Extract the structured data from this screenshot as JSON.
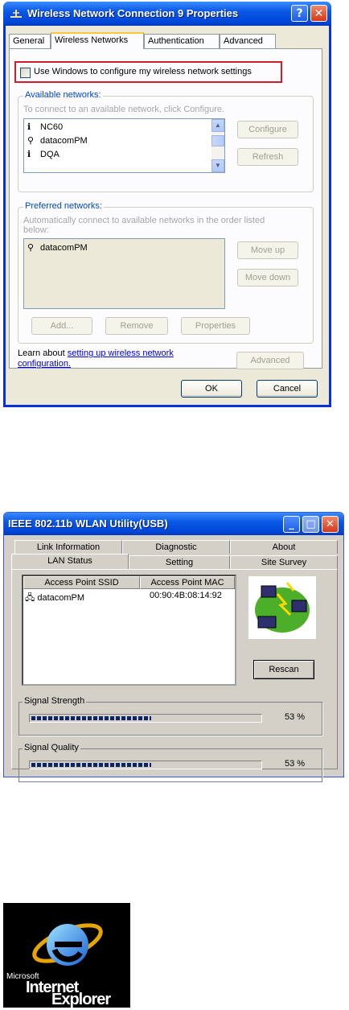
{
  "win1": {
    "title": "Wireless Network Connection 9 Properties",
    "help_glyph": "?",
    "close_glyph": "✕",
    "tabs": [
      "General",
      "Wireless Networks",
      "Authentication",
      "Advanced"
    ],
    "active_tab": "Wireless Networks",
    "checkbox_label": "Use Windows to configure my wireless network settings",
    "checkbox_checked": false,
    "available": {
      "title": "Available networks:",
      "hint": "To connect to an available network, click Configure.",
      "items": [
        {
          "name": "NC60",
          "icon": "antenna-icon"
        },
        {
          "name": "datacomPM",
          "icon": "ap-icon"
        },
        {
          "name": "DQA",
          "icon": "antenna-icon"
        }
      ],
      "configure": "Configure",
      "refresh": "Refresh"
    },
    "preferred": {
      "title": "Preferred networks:",
      "hint1": "Automatically connect to available networks in the order listed",
      "hint2": "below:",
      "items": [
        {
          "name": "datacomPM",
          "icon": "ap-icon"
        }
      ],
      "move_up": "Move up",
      "move_down": "Move down",
      "add": "Add...",
      "remove": "Remove",
      "properties": "Properties"
    },
    "learn_prefix": "Learn about ",
    "learn_link1": "setting up wireless network",
    "learn_link2": "configuration.",
    "advanced": "Advanced",
    "ok": "OK",
    "cancel": "Cancel"
  },
  "win2": {
    "title": "IEEE 802.11b WLAN Utility(USB)",
    "tabs_back": [
      "Link Information",
      "Diagnostic",
      "About"
    ],
    "tabs_front": [
      "LAN Status",
      "Setting",
      "Site Survey"
    ],
    "active_tab": "LAN Status",
    "columns": [
      "Access Point SSID",
      "Access Point MAC"
    ],
    "rows": [
      {
        "ssid": "datacomPM",
        "mac": "00:90:4B:08:14:92"
      }
    ],
    "rescan": "Rescan",
    "signal_strength": {
      "label": "Signal Strength",
      "value_text": "53 %",
      "level": 0.53
    },
    "signal_quality": {
      "label": "Signal Quality",
      "value_text": "53 %",
      "level": 0.53
    }
  },
  "ie_logo": {
    "line1": "Microsoft",
    "line2": "Internet",
    "line3": "Explorer"
  }
}
